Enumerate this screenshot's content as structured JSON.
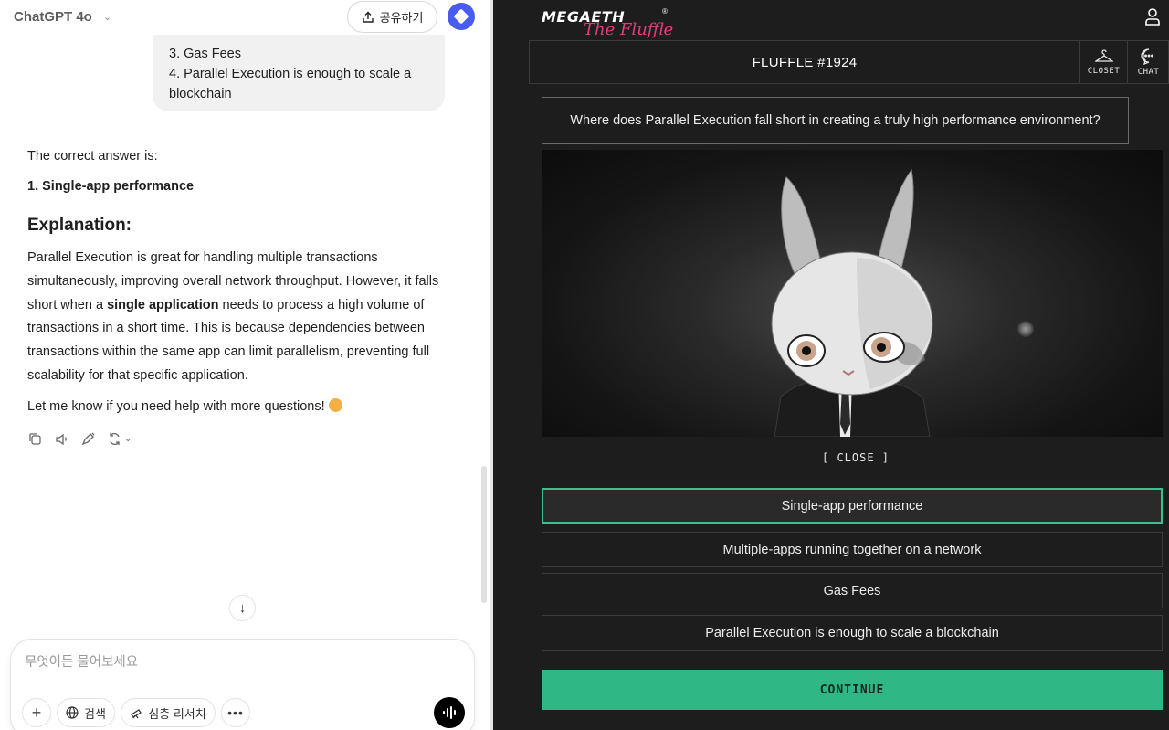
{
  "chatgpt": {
    "model": "ChatGPT 4o",
    "share_label": "공유하기",
    "user_message": {
      "line1": "3. Gas Fees",
      "line2": "4. Parallel Execution is enough to scale a",
      "line3": "blockchain"
    },
    "answer": {
      "intro": "The correct answer is:",
      "correct": "1. Single-app performance",
      "heading": "Explanation:",
      "para_before": "Parallel Execution is great for handling multiple transactions simultaneously, improving overall network throughput. However, it falls short when a ",
      "para_bold": "single application",
      "para_after": " needs to process a high volume of transactions in a short time. This is because dependencies between transactions within the same app can limit parallelism, preventing full scalability for that specific application.",
      "closing": "Let me know if you need help with more questions!"
    },
    "actions": [
      "copy-icon",
      "read-aloud-icon",
      "edit-icon",
      "regenerate-icon"
    ],
    "composer": {
      "placeholder": "무엇이든 물어보세요",
      "search_label": "검색",
      "research_label": "심층 리서치"
    }
  },
  "fluffle": {
    "logo_main": "MEGAETH",
    "logo_sub": "The Fluffle",
    "logo_reg": "®",
    "title": "FLUFFLE #1924",
    "closet_label": "CLOSET",
    "chat_label": "CHAT",
    "question": "Where does Parallel Execution fall short in creating a truly high performance environment?",
    "close_label": "[ CLOSE ]",
    "options": [
      "Single-app performance",
      "Multiple-apps running together on a network",
      "Gas Fees",
      "Parallel Execution is enough to scale a blockchain"
    ],
    "selected_option": 0,
    "continue_label": "CONTINUE",
    "colors": {
      "accent": "#2fb786",
      "selected_border": "#3fbf8f",
      "logo_pink": "#e63b7a",
      "background": "#1d1d1d"
    }
  }
}
